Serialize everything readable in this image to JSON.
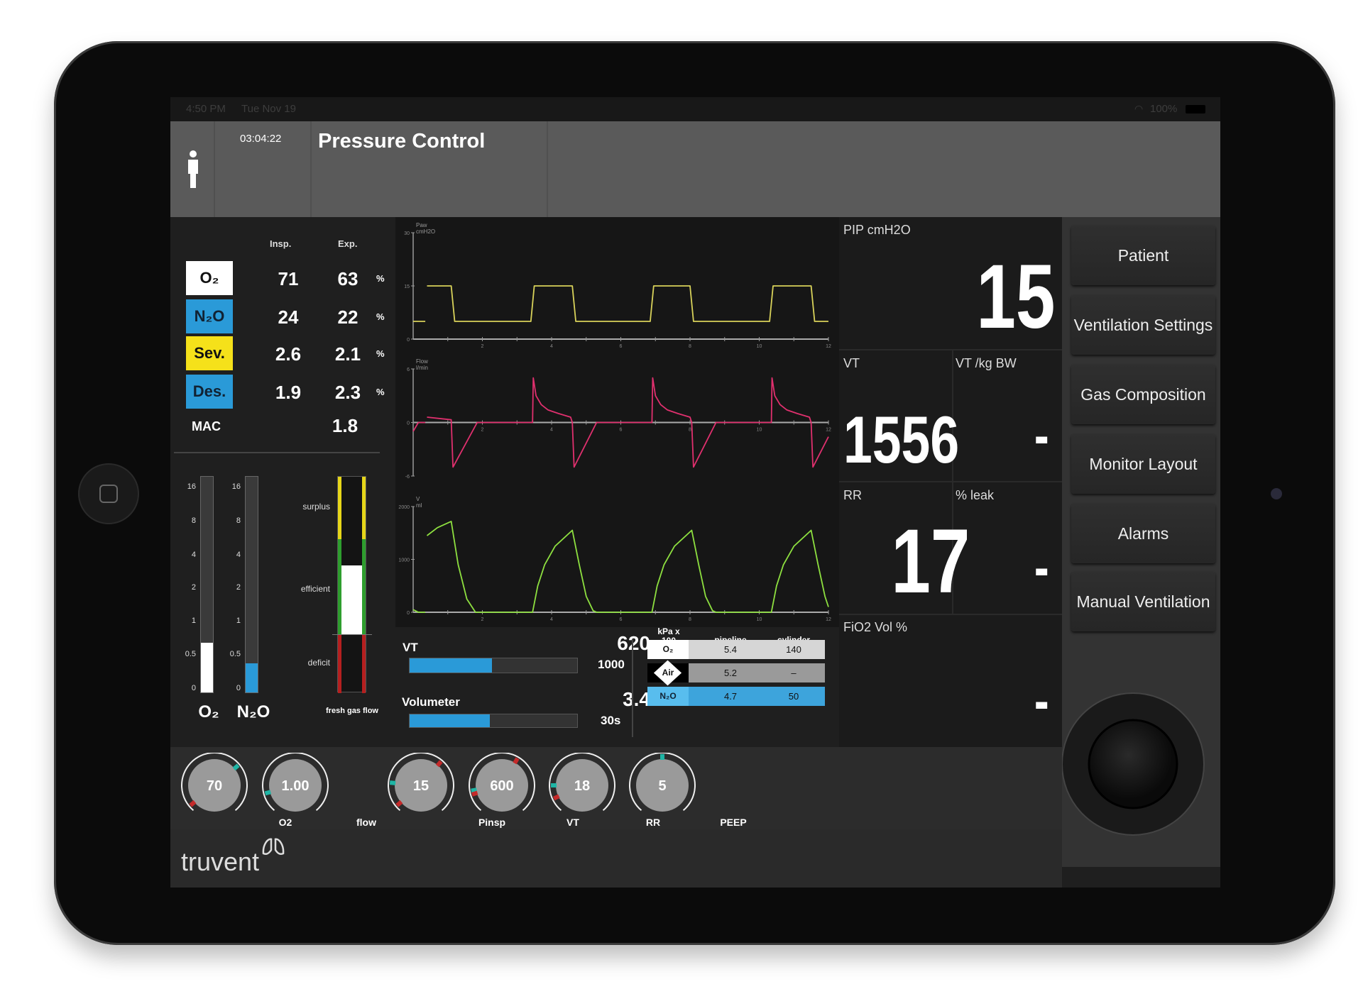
{
  "status_bar": {
    "time": "4:50 PM",
    "date": "Tue Nov 19",
    "battery": "100%"
  },
  "header": {
    "elapsed": "03:04:22",
    "mode": "Pressure Control",
    "patient_icon": "person-icon"
  },
  "gases": {
    "col_insp": "Insp.",
    "col_exp": "Exp.",
    "rows": [
      {
        "name": "O₂",
        "insp": "71",
        "exp": "63",
        "unit": "%",
        "color": "#ffffff",
        "text": "#111"
      },
      {
        "name": "N₂O",
        "insp": "24",
        "exp": "22",
        "unit": "%",
        "color": "#2a9ad8",
        "text": "#123"
      },
      {
        "name": "Sev.",
        "insp": "2.6",
        "exp": "2.1",
        "unit": "%",
        "color": "#f5e11a",
        "text": "#111"
      },
      {
        "name": "Des.",
        "insp": "1.9",
        "exp": "2.3",
        "unit": "%",
        "color": "#2a9ad8",
        "text": "#123"
      }
    ],
    "mac_label": "MAC",
    "mac_value": "1.8"
  },
  "flowmeters": {
    "ticks": [
      "16",
      "8",
      "4",
      "2",
      "1",
      "0.5",
      "0"
    ],
    "o2": {
      "label": "O₂",
      "value": 0.7,
      "color": "#ffffff"
    },
    "n2o": {
      "label": "N₂O",
      "value": 0.4,
      "color": "#2a9ad8"
    }
  },
  "fresh_gas": {
    "surplus": "surplus",
    "efficient": "efficient",
    "deficit": "deficit",
    "label": "fresh gas flow",
    "level": "efficient",
    "colors": {
      "surplus": "#e6d619",
      "efficient": "#2e9e2e",
      "deficit": "#b51f1f"
    }
  },
  "chart_data": [
    {
      "type": "line",
      "title": "Paw",
      "ylabel": "cmH2O",
      "xlim": [
        0,
        12
      ],
      "ylim": [
        0,
        30
      ],
      "yticks": [
        "0",
        "15",
        "30"
      ],
      "xticks": [
        "2",
        "4",
        "6",
        "8",
        "10",
        "12"
      ],
      "color": "#d8d25a",
      "points": [
        [
          0,
          5
        ],
        [
          0.35,
          5
        ],
        [
          null,
          null
        ],
        [
          0.4,
          15
        ],
        [
          1.1,
          15
        ],
        [
          1.2,
          5
        ],
        [
          3.4,
          5
        ],
        [
          3.5,
          15
        ],
        [
          4.6,
          15
        ],
        [
          4.7,
          5
        ],
        [
          6.85,
          5
        ],
        [
          6.95,
          15
        ],
        [
          8.0,
          15
        ],
        [
          8.1,
          5
        ],
        [
          10.3,
          5
        ],
        [
          10.4,
          15
        ],
        [
          11.5,
          15
        ],
        [
          11.6,
          5
        ],
        [
          12,
          5
        ]
      ]
    },
    {
      "type": "line",
      "title": "Flow",
      "ylabel": "l/min",
      "xlim": [
        0,
        12
      ],
      "ylim": [
        -6,
        6
      ],
      "yticks": [
        "-6",
        "0",
        "6"
      ],
      "xticks": [
        "2",
        "4",
        "6",
        "8",
        "10",
        "12"
      ],
      "color": "#e0306e",
      "points": [
        [
          0,
          -1
        ],
        [
          0.15,
          0
        ],
        [
          0.35,
          0
        ],
        [
          null,
          null
        ],
        [
          0.4,
          0.6
        ],
        [
          1.1,
          0.3
        ],
        [
          1.15,
          -5
        ],
        [
          1.85,
          0
        ],
        [
          3.45,
          0
        ],
        [
          3.47,
          5
        ],
        [
          3.55,
          3
        ],
        [
          3.7,
          2
        ],
        [
          3.9,
          1.4
        ],
        [
          4.2,
          1.0
        ],
        [
          4.55,
          0.6
        ],
        [
          4.6,
          0
        ],
        [
          4.65,
          -5
        ],
        [
          5.3,
          0
        ],
        [
          6.9,
          0
        ],
        [
          6.92,
          5
        ],
        [
          7.0,
          3
        ],
        [
          7.15,
          2
        ],
        [
          7.35,
          1.4
        ],
        [
          7.65,
          1.0
        ],
        [
          8.0,
          0.6
        ],
        [
          8.05,
          0
        ],
        [
          8.1,
          -5
        ],
        [
          8.75,
          0
        ],
        [
          10.35,
          0
        ],
        [
          10.37,
          5
        ],
        [
          10.45,
          3
        ],
        [
          10.6,
          2
        ],
        [
          10.8,
          1.4
        ],
        [
          11.1,
          1.0
        ],
        [
          11.45,
          0.6
        ],
        [
          11.5,
          0
        ],
        [
          11.55,
          -5
        ],
        [
          12,
          -1.6
        ]
      ]
    },
    {
      "type": "line",
      "title": "V",
      "ylabel": "ml",
      "xlim": [
        0,
        12
      ],
      "ylim": [
        0,
        2000
      ],
      "yticks": [
        "0",
        "1000",
        "2000"
      ],
      "xticks": [
        "2",
        "4",
        "6",
        "8",
        "10",
        "12"
      ],
      "color": "#8ee040",
      "points": [
        [
          0,
          50
        ],
        [
          0.15,
          0
        ],
        [
          0.35,
          0
        ],
        [
          null,
          null
        ],
        [
          0.4,
          1450
        ],
        [
          0.7,
          1600
        ],
        [
          1.1,
          1720
        ],
        [
          1.3,
          900
        ],
        [
          1.55,
          250
        ],
        [
          1.8,
          0
        ],
        [
          3.45,
          0
        ],
        [
          3.6,
          500
        ],
        [
          3.8,
          900
        ],
        [
          4.1,
          1250
        ],
        [
          4.6,
          1550
        ],
        [
          4.8,
          900
        ],
        [
          5.0,
          300
        ],
        [
          5.2,
          30
        ],
        [
          5.3,
          0
        ],
        [
          6.9,
          0
        ],
        [
          7.05,
          500
        ],
        [
          7.25,
          900
        ],
        [
          7.55,
          1250
        ],
        [
          8.05,
          1550
        ],
        [
          8.25,
          900
        ],
        [
          8.45,
          300
        ],
        [
          8.65,
          30
        ],
        [
          8.75,
          0
        ],
        [
          10.35,
          0
        ],
        [
          10.5,
          500
        ],
        [
          10.7,
          900
        ],
        [
          11.0,
          1250
        ],
        [
          11.5,
          1550
        ],
        [
          11.7,
          900
        ],
        [
          11.9,
          300
        ],
        [
          12,
          100
        ]
      ]
    }
  ],
  "vt": {
    "label": "VT",
    "value": "620",
    "max": "1000",
    "fill": 0.49
  },
  "volumeter": {
    "label": "Volumeter",
    "value": "3.4",
    "period": "30s",
    "fill": 0.48
  },
  "supply": {
    "header": [
      "kPa x 100",
      "pipeline",
      "cylinder"
    ],
    "rows": [
      {
        "gas": "O₂",
        "pipeline": "5.4",
        "cylinder": "140",
        "bg": "#d6d6d6",
        "tag": "#ffffff"
      },
      {
        "gas": "Air",
        "pipeline": "5.2",
        "cylinder": "–",
        "bg": "#9a9a9a",
        "tag": "#000000"
      },
      {
        "gas": "N₂O",
        "pipeline": "4.7",
        "cylinder": "50",
        "bg": "#3da4dc",
        "tag": "#58bdee"
      }
    ]
  },
  "numerics": {
    "pip": {
      "label": "PIP cmH2O",
      "value": "15"
    },
    "vt": {
      "label": "VT",
      "value": "1556"
    },
    "vt_kg": {
      "label": "VT /kg BW",
      "value": "-"
    },
    "rr": {
      "label": "RR",
      "value": "17"
    },
    "leak": {
      "label": "% leak",
      "value": "-"
    },
    "fio2": {
      "label": "FiO2 Vol %",
      "value": "-"
    }
  },
  "menu": [
    {
      "label": "Patient"
    },
    {
      "label": "Ventilation Settings"
    },
    {
      "label": "Gas Composition"
    },
    {
      "label": "Monitor Layout"
    },
    {
      "label": "Alarms"
    },
    {
      "label": "Manual Ventilation"
    }
  ],
  "knobs": [
    {
      "label": "O2",
      "value": "70"
    },
    {
      "label": "flow",
      "value": "1.00"
    },
    {
      "label": "Pinsp",
      "value": "15"
    },
    {
      "label": "VT",
      "value": "600"
    },
    {
      "label": "RR",
      "value": "18"
    },
    {
      "label": "PEEP",
      "value": "5"
    }
  ],
  "brand": {
    "name": "truvent",
    "logo_icon": "lungs-icon"
  },
  "colors": {
    "accent": "#2a9ad8",
    "alarm": "#c42a2a",
    "limit": "#1fb5a5"
  }
}
